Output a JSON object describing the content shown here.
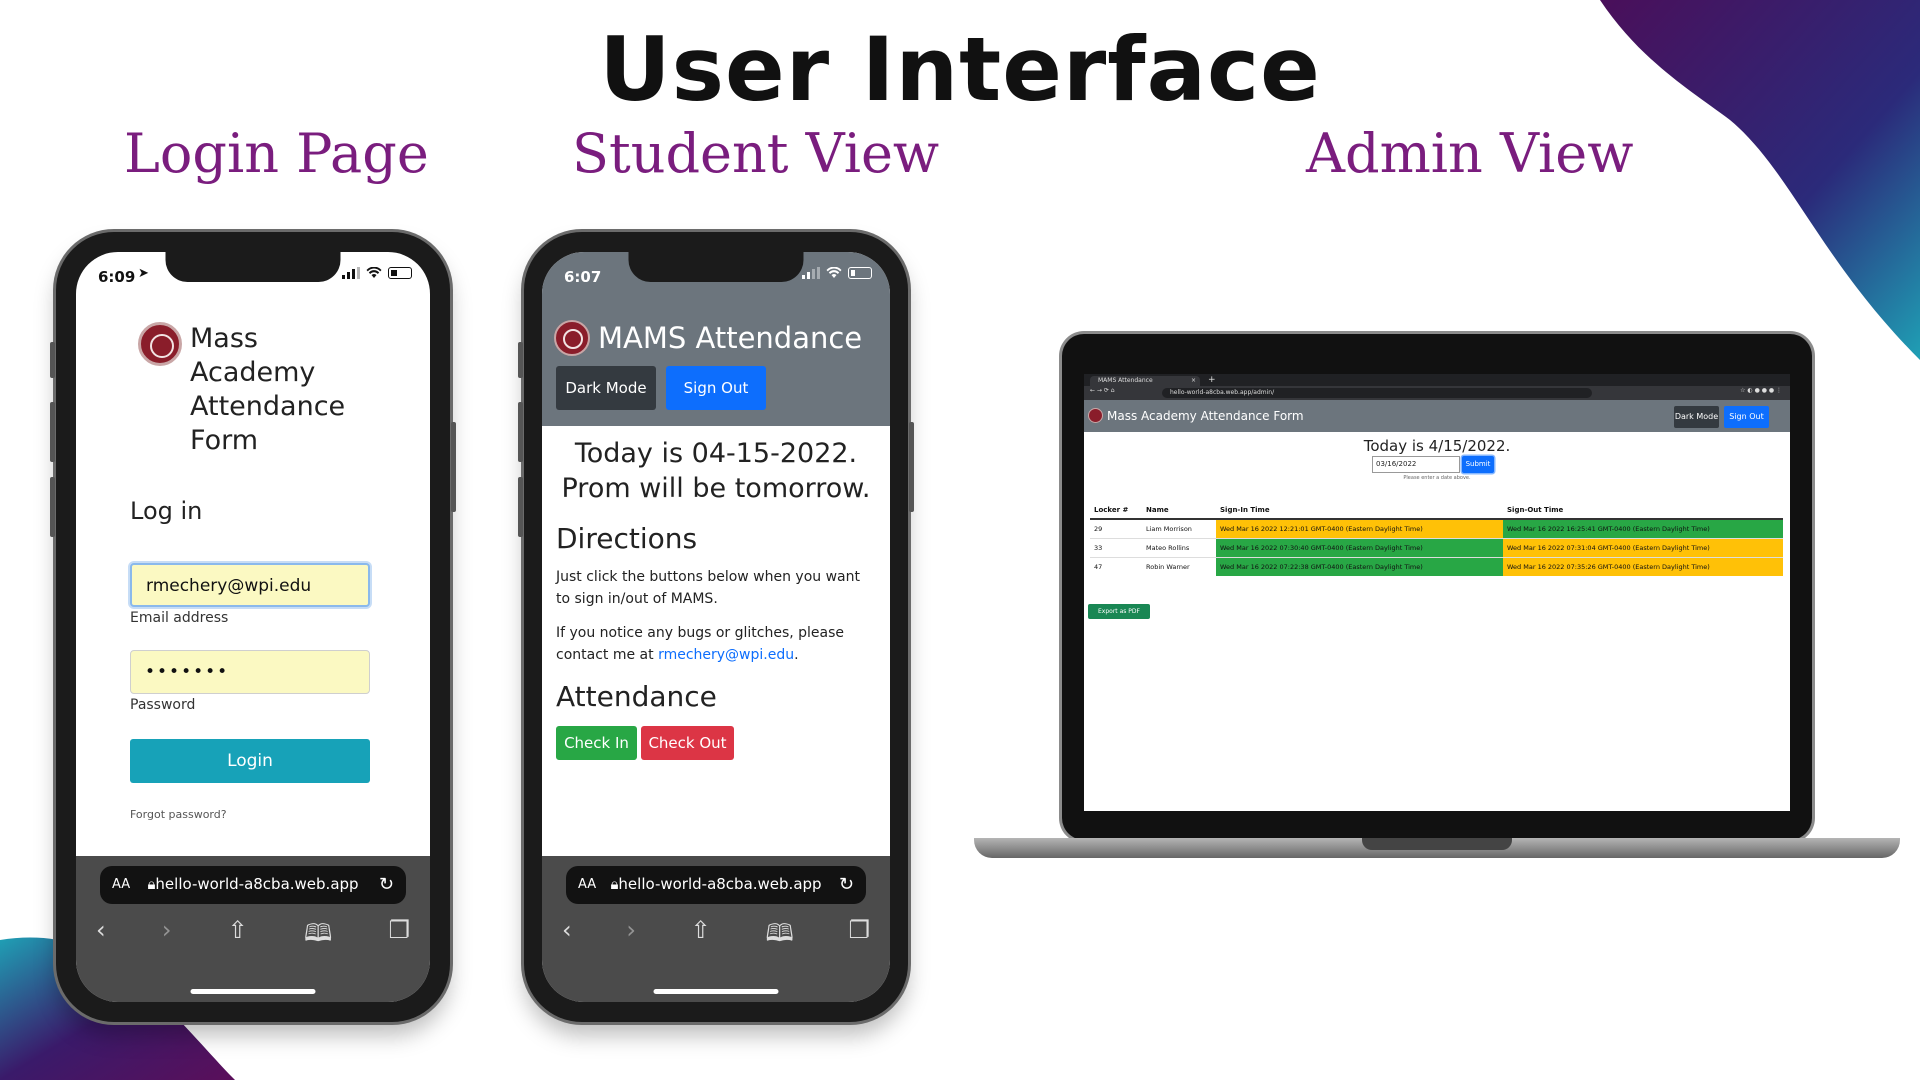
{
  "title": "User Interface",
  "sections": {
    "login": "Login Page",
    "student": "Student View",
    "admin": "Admin View"
  },
  "login_phone": {
    "time": "6:09",
    "app_title": [
      "Mass",
      "Academy",
      "Attendance",
      "Form"
    ],
    "heading": "Log in",
    "email_value": "rmechery@wpi.edu",
    "email_label": "Email address",
    "password_value": "•••••••",
    "password_label": "Password",
    "login_button": "Login",
    "forgot": "Forgot password?",
    "url": "hello-world-a8cba.web.app",
    "aa": "AA"
  },
  "student_phone": {
    "time": "6:07",
    "brand": "MAMS Attendance",
    "dark_mode": "Dark Mode",
    "sign_out": "Sign Out",
    "date_line1": "Today is 04-15-2022.",
    "date_line2": "Prom will be tomorrow.",
    "directions_heading": "Directions",
    "directions_text": "Just click the buttons below when you want to sign in/out of MAMS.",
    "bugs_text": "If you notice any bugs or glitches, please contact me at ",
    "bugs_link": "rmechery@wpi.edu",
    "bugs_end": ".",
    "attendance_heading": "Attendance",
    "check_in": "Check In",
    "check_out": "Check Out",
    "url": "hello-world-a8cba.web.app",
    "aa": "AA"
  },
  "admin": {
    "tab_title": "MAMS Attendance",
    "url": "hello-world-a8cba.web.app/admin/",
    "brand": "Mass Academy Attendance Form",
    "dark_mode": "Dark Mode",
    "sign_out": "Sign Out",
    "date": "Today is 4/15/2022.",
    "date_input": "03/16/2022",
    "submit": "Submit",
    "help": "Please enter a date above.",
    "columns": [
      "Locker #",
      "Name",
      "Sign-In Time",
      "Sign-Out Time"
    ],
    "rows": [
      {
        "locker": "29",
        "name": "Liam Morrison",
        "sign_in": "Wed Mar 16 2022 12:21:01 GMT-0400 (Eastern Daylight Time)",
        "sign_out": "Wed Mar 16 2022 16:25:41 GMT-0400 (Eastern Daylight Time)",
        "in_status": "late",
        "out_status": "ok"
      },
      {
        "locker": "33",
        "name": "Mateo Rollins",
        "sign_in": "Wed Mar 16 2022 07:30:40 GMT-0400 (Eastern Daylight Time)",
        "sign_out": "Wed Mar 16 2022 07:31:04 GMT-0400 (Eastern Daylight Time)",
        "in_status": "ok",
        "out_status": "late"
      },
      {
        "locker": "47",
        "name": "Robin Warner",
        "sign_in": "Wed Mar 16 2022 07:22:38 GMT-0400 (Eastern Daylight Time)",
        "sign_out": "Wed Mar 16 2022 07:35:26 GMT-0400 (Eastern Daylight Time)",
        "in_status": "ok",
        "out_status": "late"
      }
    ],
    "export": "Export as PDF"
  },
  "colors": {
    "accent_purple": "#7a1d7e",
    "teal": "#17a2b8",
    "primary_blue": "#0d6efd",
    "success_green": "#28a745",
    "danger_red": "#dc3545",
    "warning_yellow": "#ffc107",
    "navbar_gray": "#6c757d"
  }
}
